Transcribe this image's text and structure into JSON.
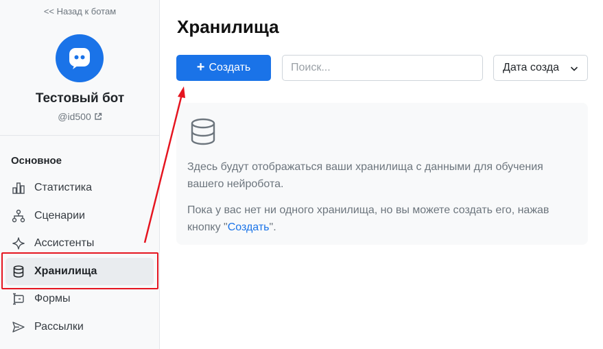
{
  "sidebar": {
    "back_link": "<< Назад к ботам",
    "bot_name": "Тестовый бот",
    "bot_handle": "@id500",
    "section_title": "Основное",
    "items": [
      {
        "label": "Статистика",
        "icon": "bar-chart-icon"
      },
      {
        "label": "Сценарии",
        "icon": "flow-icon"
      },
      {
        "label": "Ассистенты",
        "icon": "sparkle-icon"
      },
      {
        "label": "Хранилища",
        "icon": "database-icon",
        "active": true
      },
      {
        "label": "Формы",
        "icon": "form-icon"
      },
      {
        "label": "Рассылки",
        "icon": "send-icon"
      }
    ]
  },
  "main": {
    "title": "Хранилища",
    "create_label": "Создать",
    "search_placeholder": "Поиск...",
    "sort_label": "Дата созда",
    "empty_line1": "Здесь будут отображаться ваши хранилища с данными для обучения вашего нейробота.",
    "empty_line2_prefix": "Пока у вас нет ни одного хранилища, но вы можете создать его, нажав кнопку \"",
    "empty_line2_link": "Создать",
    "empty_line2_suffix": "\"."
  },
  "colors": {
    "accent": "#1a73e8",
    "annotation": "#e5141f"
  }
}
